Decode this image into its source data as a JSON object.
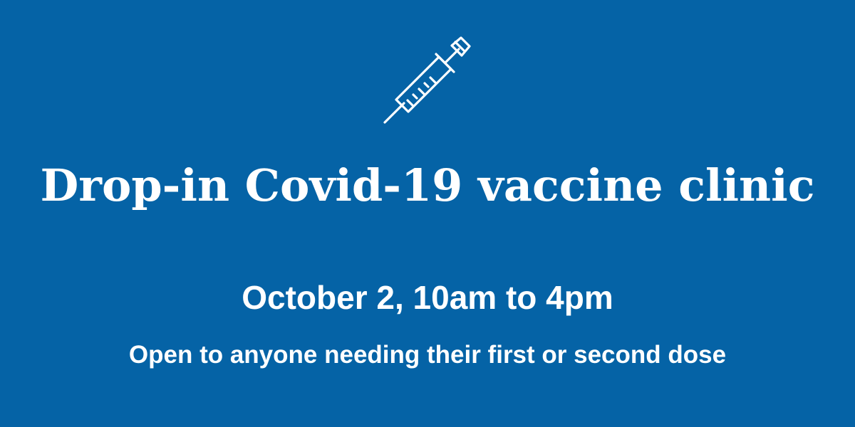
{
  "banner": {
    "icon": "syringe-icon",
    "headline": "Drop-in Covid-19 vaccine clinic",
    "date_line": "October 2, 10am to 4pm",
    "subline": "Open to anyone needing their first or second dose",
    "colors": {
      "background": "#0563A6",
      "text": "#FFFFFF"
    }
  }
}
